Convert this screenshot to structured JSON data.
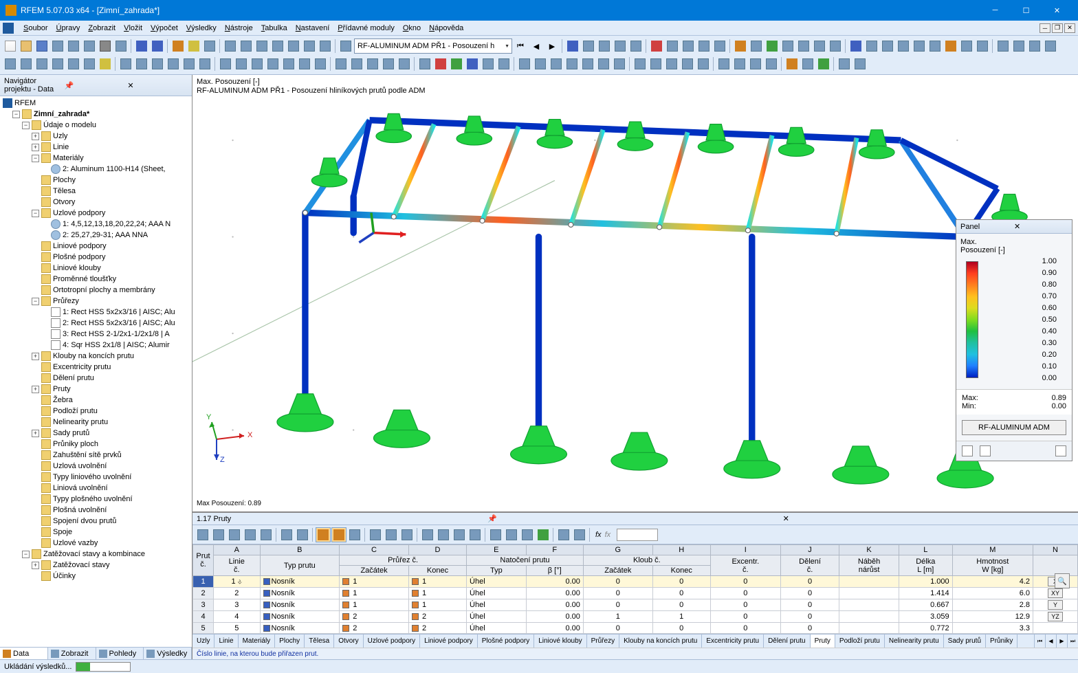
{
  "title": "RFEM 5.07.03 x64 - [Zimní_zahrada*]",
  "menu": [
    "Soubor",
    "Úpravy",
    "Zobrazit",
    "Vložit",
    "Výpočet",
    "Výsledky",
    "Nástroje",
    "Tabulka",
    "Nastavení",
    "Přídavné moduly",
    "Okno",
    "Nápověda"
  ],
  "menu_keys": [
    0,
    0,
    0,
    0,
    0,
    0,
    0,
    0,
    0,
    0,
    0,
    0
  ],
  "toolbar_dropdown": "RF-ALUMINUM ADM PŘ1 - Posouzení h",
  "navigator": {
    "title": "Navigátor projektu - Data",
    "root": "RFEM",
    "model": "Zimní_zahrada*",
    "udaje": "Údaje o modelu",
    "items": [
      {
        "t": "Uzly",
        "l": 3,
        "exp": "+"
      },
      {
        "t": "Linie",
        "l": 3,
        "exp": "+"
      },
      {
        "t": "Materiály",
        "l": 3,
        "exp": "-"
      },
      {
        "t": "2: Aluminum 1100-H14 (Sheet,",
        "l": 4,
        "ico": "node",
        "exp": ""
      },
      {
        "t": "Plochy",
        "l": 3,
        "exp": ""
      },
      {
        "t": "Tělesa",
        "l": 3,
        "exp": ""
      },
      {
        "t": "Otvory",
        "l": 3,
        "exp": ""
      },
      {
        "t": "Uzlové podpory",
        "l": 3,
        "exp": "-"
      },
      {
        "t": "1: 4,5,12,13,18,20,22,24; AAA N",
        "l": 4,
        "ico": "node",
        "exp": ""
      },
      {
        "t": "2: 25,27,29-31; AAA NNA",
        "l": 4,
        "ico": "node",
        "exp": ""
      },
      {
        "t": "Liniové podpory",
        "l": 3,
        "exp": ""
      },
      {
        "t": "Plošné podpory",
        "l": 3,
        "exp": ""
      },
      {
        "t": "Liniové klouby",
        "l": 3,
        "exp": ""
      },
      {
        "t": "Proměnné tloušťky",
        "l": 3,
        "exp": ""
      },
      {
        "t": "Ortotropní plochy a membrány",
        "l": 3,
        "exp": ""
      },
      {
        "t": "Průřezy",
        "l": 3,
        "exp": "-"
      },
      {
        "t": "1: Rect HSS 5x2x3/16 | AISC; Alu",
        "l": 4,
        "ico": "doc",
        "exp": ""
      },
      {
        "t": "2: Rect HSS 5x2x3/16 | AISC; Alu",
        "l": 4,
        "ico": "doc",
        "exp": ""
      },
      {
        "t": "3: Rect HSS 2-1/2x1-1/2x1/8 | A",
        "l": 4,
        "ico": "doc",
        "exp": ""
      },
      {
        "t": "4: Sqr HSS 2x1/8 | AISC; Alumir",
        "l": 4,
        "ico": "doc",
        "exp": ""
      },
      {
        "t": "Klouby na koncích prutu",
        "l": 3,
        "exp": "+"
      },
      {
        "t": "Excentricity prutu",
        "l": 3,
        "exp": ""
      },
      {
        "t": "Dělení prutu",
        "l": 3,
        "exp": ""
      },
      {
        "t": "Pruty",
        "l": 3,
        "exp": "+"
      },
      {
        "t": "Žebra",
        "l": 3,
        "exp": ""
      },
      {
        "t": "Podloží prutu",
        "l": 3,
        "exp": ""
      },
      {
        "t": "Nelinearity prutu",
        "l": 3,
        "exp": ""
      },
      {
        "t": "Sady prutů",
        "l": 3,
        "exp": "+"
      },
      {
        "t": "Průniky ploch",
        "l": 3,
        "exp": ""
      },
      {
        "t": "Zahuštění sítě prvků",
        "l": 3,
        "exp": ""
      },
      {
        "t": "Uzlová uvolnění",
        "l": 3,
        "exp": ""
      },
      {
        "t": "Typy liniového uvolnění",
        "l": 3,
        "exp": ""
      },
      {
        "t": "Liniová uvolnění",
        "l": 3,
        "exp": ""
      },
      {
        "t": "Typy plošného uvolnění",
        "l": 3,
        "exp": ""
      },
      {
        "t": "Plošná uvolnění",
        "l": 3,
        "exp": ""
      },
      {
        "t": "Spojení dvou prutů",
        "l": 3,
        "exp": ""
      },
      {
        "t": "Spoje",
        "l": 3,
        "exp": ""
      },
      {
        "t": "Uzlové vazby",
        "l": 3,
        "exp": ""
      }
    ],
    "zatez": "Zatěžovací stavy a kombinace",
    "zatez_items": [
      "Zatěžovací stavy",
      "Účinky"
    ],
    "tabs": [
      "Data",
      "Zobrazit",
      "Pohledy",
      "Výsledky"
    ]
  },
  "viewport": {
    "line1": "Max. Posouzení [-]",
    "line2": "RF-ALUMINUM ADM PŘ1 - Posouzení hliníkových prutů podle ADM",
    "max": "Max Posouzení: 0.89"
  },
  "panel": {
    "title": "Panel",
    "sub1": "Max.",
    "sub2": "Posouzení [-]",
    "scale": [
      "1.00",
      "0.90",
      "0.80",
      "0.70",
      "0.60",
      "0.50",
      "0.40",
      "0.30",
      "0.20",
      "0.10",
      "0.00"
    ],
    "max_label": "Max:",
    "max_val": "0.89",
    "min_label": "Min:",
    "min_val": "0.00",
    "btn": "RF-ALUMINUM ADM"
  },
  "table": {
    "title": "1.17 Pruty",
    "cols_letters": [
      "A",
      "B",
      "C",
      "D",
      "E",
      "F",
      "G",
      "H",
      "I",
      "J",
      "K",
      "L",
      "M",
      "N"
    ],
    "group_headers": {
      "prurez": "Průřez č.",
      "natoc": "Natočení prutu",
      "kloub": "Kloub č."
    },
    "headers": {
      "prut": "Prut\nč.",
      "linie": "Linie\nč.",
      "typ": "Typ prutu",
      "zacatek": "Začátek",
      "konec": "Konec",
      "ntyp": "Typ",
      "beta": "β [°]",
      "kzac": "Začátek",
      "kkon": "Konec",
      "exc": "Excentr.\nč.",
      "del": "Dělení\nč.",
      "nabeh": "Náběh\nnárůst",
      "delka": "Délka\nL [m]",
      "hmot": "Hmotnost\nW [kg]"
    },
    "rows": [
      {
        "n": "1",
        "linie": "1",
        "typ": "Nosník",
        "pz": "1",
        "pk": "1",
        "nt": "Úhel",
        "b": "0.00",
        "kz": "0",
        "kk": "0",
        "e": "0",
        "d": "0",
        "nb": "",
        "l": "1.000",
        "w": "4.2",
        "ax": "X"
      },
      {
        "n": "2",
        "linie": "2",
        "typ": "Nosník",
        "pz": "1",
        "pk": "1",
        "nt": "Úhel",
        "b": "0.00",
        "kz": "0",
        "kk": "0",
        "e": "0",
        "d": "0",
        "nb": "",
        "l": "1.414",
        "w": "6.0",
        "ax": "XY"
      },
      {
        "n": "3",
        "linie": "3",
        "typ": "Nosník",
        "pz": "1",
        "pk": "1",
        "nt": "Úhel",
        "b": "0.00",
        "kz": "0",
        "kk": "0",
        "e": "0",
        "d": "0",
        "nb": "",
        "l": "0.667",
        "w": "2.8",
        "ax": "Y"
      },
      {
        "n": "4",
        "linie": "4",
        "typ": "Nosník",
        "pz": "2",
        "pk": "2",
        "nt": "Úhel",
        "b": "0.00",
        "kz": "1",
        "kk": "1",
        "e": "0",
        "d": "0",
        "nb": "",
        "l": "3.059",
        "w": "12.9",
        "ax": "YZ"
      },
      {
        "n": "5",
        "linie": "5",
        "typ": "Nosník",
        "pz": "2",
        "pk": "2",
        "nt": "Úhel",
        "b": "0.00",
        "kz": "0",
        "kk": "0",
        "e": "0",
        "d": "0",
        "nb": "",
        "l": "0.772",
        "w": "3.3",
        "ax": ""
      }
    ],
    "tabs": [
      "Uzly",
      "Linie",
      "Materiály",
      "Plochy",
      "Tělesa",
      "Otvory",
      "Uzlové podpory",
      "Liniové podpory",
      "Plošné podpory",
      "Liniové klouby",
      "Průřezy",
      "Klouby na koncích prutu",
      "Excentricity prutu",
      "Dělení prutu",
      "Pruty",
      "Podloží prutu",
      "Nelinearity prutu",
      "Sady prutů",
      "Průniky"
    ],
    "hint": "Číslo linie, na kterou bude přiřazen prut."
  },
  "status": "Ukládání výsledků..."
}
